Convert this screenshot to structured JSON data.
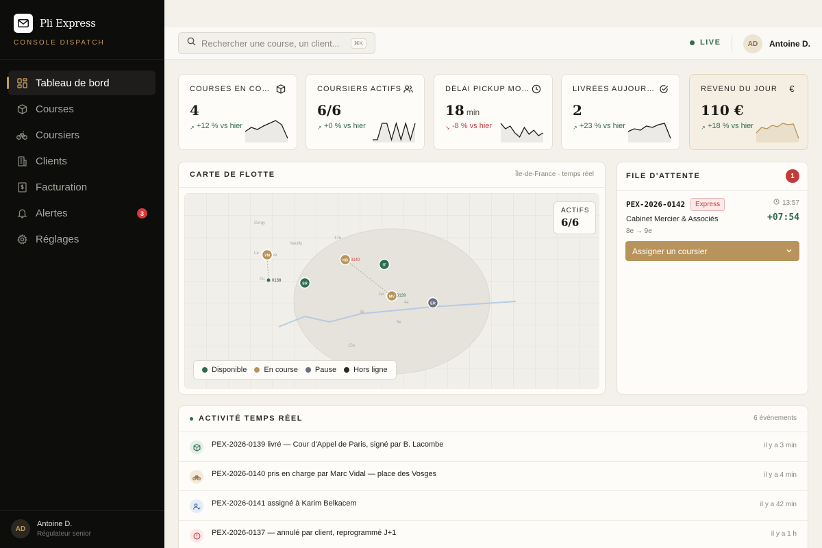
{
  "brand": {
    "name": "Pli Express",
    "subtitle": "CONSOLE DISPATCH"
  },
  "sidebar": {
    "items": [
      {
        "label": "Tableau de bord",
        "icon": "grid-icon",
        "active": true
      },
      {
        "label": "Courses",
        "icon": "package-icon"
      },
      {
        "label": "Coursiers",
        "icon": "bike-icon"
      },
      {
        "label": "Clients",
        "icon": "building-icon"
      },
      {
        "label": "Facturation",
        "icon": "invoice-icon"
      },
      {
        "label": "Alertes",
        "icon": "bell-icon",
        "badge": "3"
      },
      {
        "label": "Réglages",
        "icon": "gear-icon"
      }
    ],
    "user": {
      "initials": "AD",
      "name": "Antoine D.",
      "role": "Régulateur senior"
    }
  },
  "topbar": {
    "search_placeholder": "Rechercher une course, un client...",
    "shortcut": "⌘K",
    "live": "LIVE",
    "user": {
      "initials": "AD",
      "name": "Antoine D."
    }
  },
  "kpis": [
    {
      "title": "COURSES EN COURS",
      "value": "4",
      "unit": "",
      "delta": "+12 % vs hier",
      "positive": true,
      "icon": "box-icon",
      "spark": [
        18,
        12,
        15,
        10,
        6,
        2,
        8,
        28
      ]
    },
    {
      "title": "COURSIERS ACTIFS",
      "value": "6/6",
      "unit": "",
      "delta": "+0 % vs hier",
      "positive": true,
      "icon": "users-icon",
      "spark": [
        30,
        30,
        6,
        6,
        30,
        6,
        30,
        6,
        30,
        6
      ]
    },
    {
      "title": "DÉLAI PICKUP MOYEN",
      "value": "18",
      "unit": "min",
      "delta": "-8 % vs hier",
      "positive": false,
      "icon": "clock-icon",
      "spark": [
        6,
        14,
        10,
        20,
        26,
        12,
        22,
        16,
        24,
        20
      ]
    },
    {
      "title": "LIVRÉES AUJOURD'HUI",
      "value": "2",
      "unit": "",
      "delta": "+23 % vs hier",
      "positive": true,
      "icon": "check-circle-icon",
      "spark": [
        18,
        14,
        16,
        10,
        12,
        8,
        6,
        28
      ]
    },
    {
      "title": "REVENU DU JOUR",
      "value": "110 €",
      "unit": "",
      "delta": "+18 % vs hier",
      "positive": true,
      "icon": "euro-icon",
      "spark": [
        20,
        12,
        14,
        9,
        11,
        6,
        8,
        7,
        28
      ],
      "highlight": true
    }
  ],
  "map": {
    "title": "CARTE DE FLOTTE",
    "subtitle": "Île-de-France · temps réel",
    "actifs_label": "ACTIFS",
    "actifs_value": "6/6",
    "place_labels": [
      "Cergy",
      "Neuilly",
      "17e",
      "La",
      "ve",
      "Pu",
      "1er",
      "4e",
      "3e",
      "5e",
      "15e"
    ],
    "couriers": [
      {
        "initials": "YM",
        "status": "en-course"
      },
      {
        "initials": "SR",
        "status": "disponible"
      },
      {
        "initials": "KB",
        "status": "en-course"
      },
      {
        "initials": "IT",
        "status": "disponible"
      },
      {
        "initials": "MV",
        "status": "en-course"
      },
      {
        "initials": "ER",
        "status": "pause"
      }
    ],
    "tags": [
      "0138",
      "0140",
      "0139"
    ],
    "legend": [
      {
        "label": "Disponible",
        "color": "#2f6b4d"
      },
      {
        "label": "En course",
        "color": "#b8935b"
      },
      {
        "label": "Pause",
        "color": "#6b7080"
      },
      {
        "label": "Hors ligne",
        "color": "#2a2824"
      }
    ]
  },
  "queue": {
    "title": "FILE D'ATTENTE",
    "count": "1",
    "item": {
      "ref": "PEX-2026-0142",
      "tag": "Express",
      "time": "13:57",
      "client": "Cabinet Mercier & Associés",
      "eta": "+07:54",
      "route": "8e → 9e",
      "button": "Assigner un coursier"
    }
  },
  "activity": {
    "title": "ACTIVITÉ TEMPS RÉEL",
    "count": "6 événements",
    "events": [
      {
        "text": "PEX-2026-0139 livré — Cour d'Appel de Paris, signé par B. Lacombe",
        "time": "il y a 3 min",
        "icon": "box-icon",
        "color": "#2f6b4d",
        "bg": "#e3efe7"
      },
      {
        "text": "PEX-2026-0140 pris en charge par Marc Vidal — place des Vosges",
        "time": "il y a 4 min",
        "icon": "bike-icon",
        "color": "#8e6a36",
        "bg": "#f3ead9"
      },
      {
        "text": "PEX-2026-0141 assigné à Karim Belkacem",
        "time": "il y a 42 min",
        "icon": "user-check-icon",
        "color": "#3e5f9b",
        "bg": "#e6ecf6"
      },
      {
        "text": "PEX-2026-0137 — annulé par client, reprogrammé J+1",
        "time": "il y a 1 h",
        "icon": "alert-icon",
        "color": "#c23b3b",
        "bg": "#fbe7e7"
      }
    ]
  },
  "colors": {
    "accent": "#b8935b",
    "positive": "#2f6b4d",
    "negative": "#c23b3b",
    "sidebar": "#0d0d0c"
  }
}
